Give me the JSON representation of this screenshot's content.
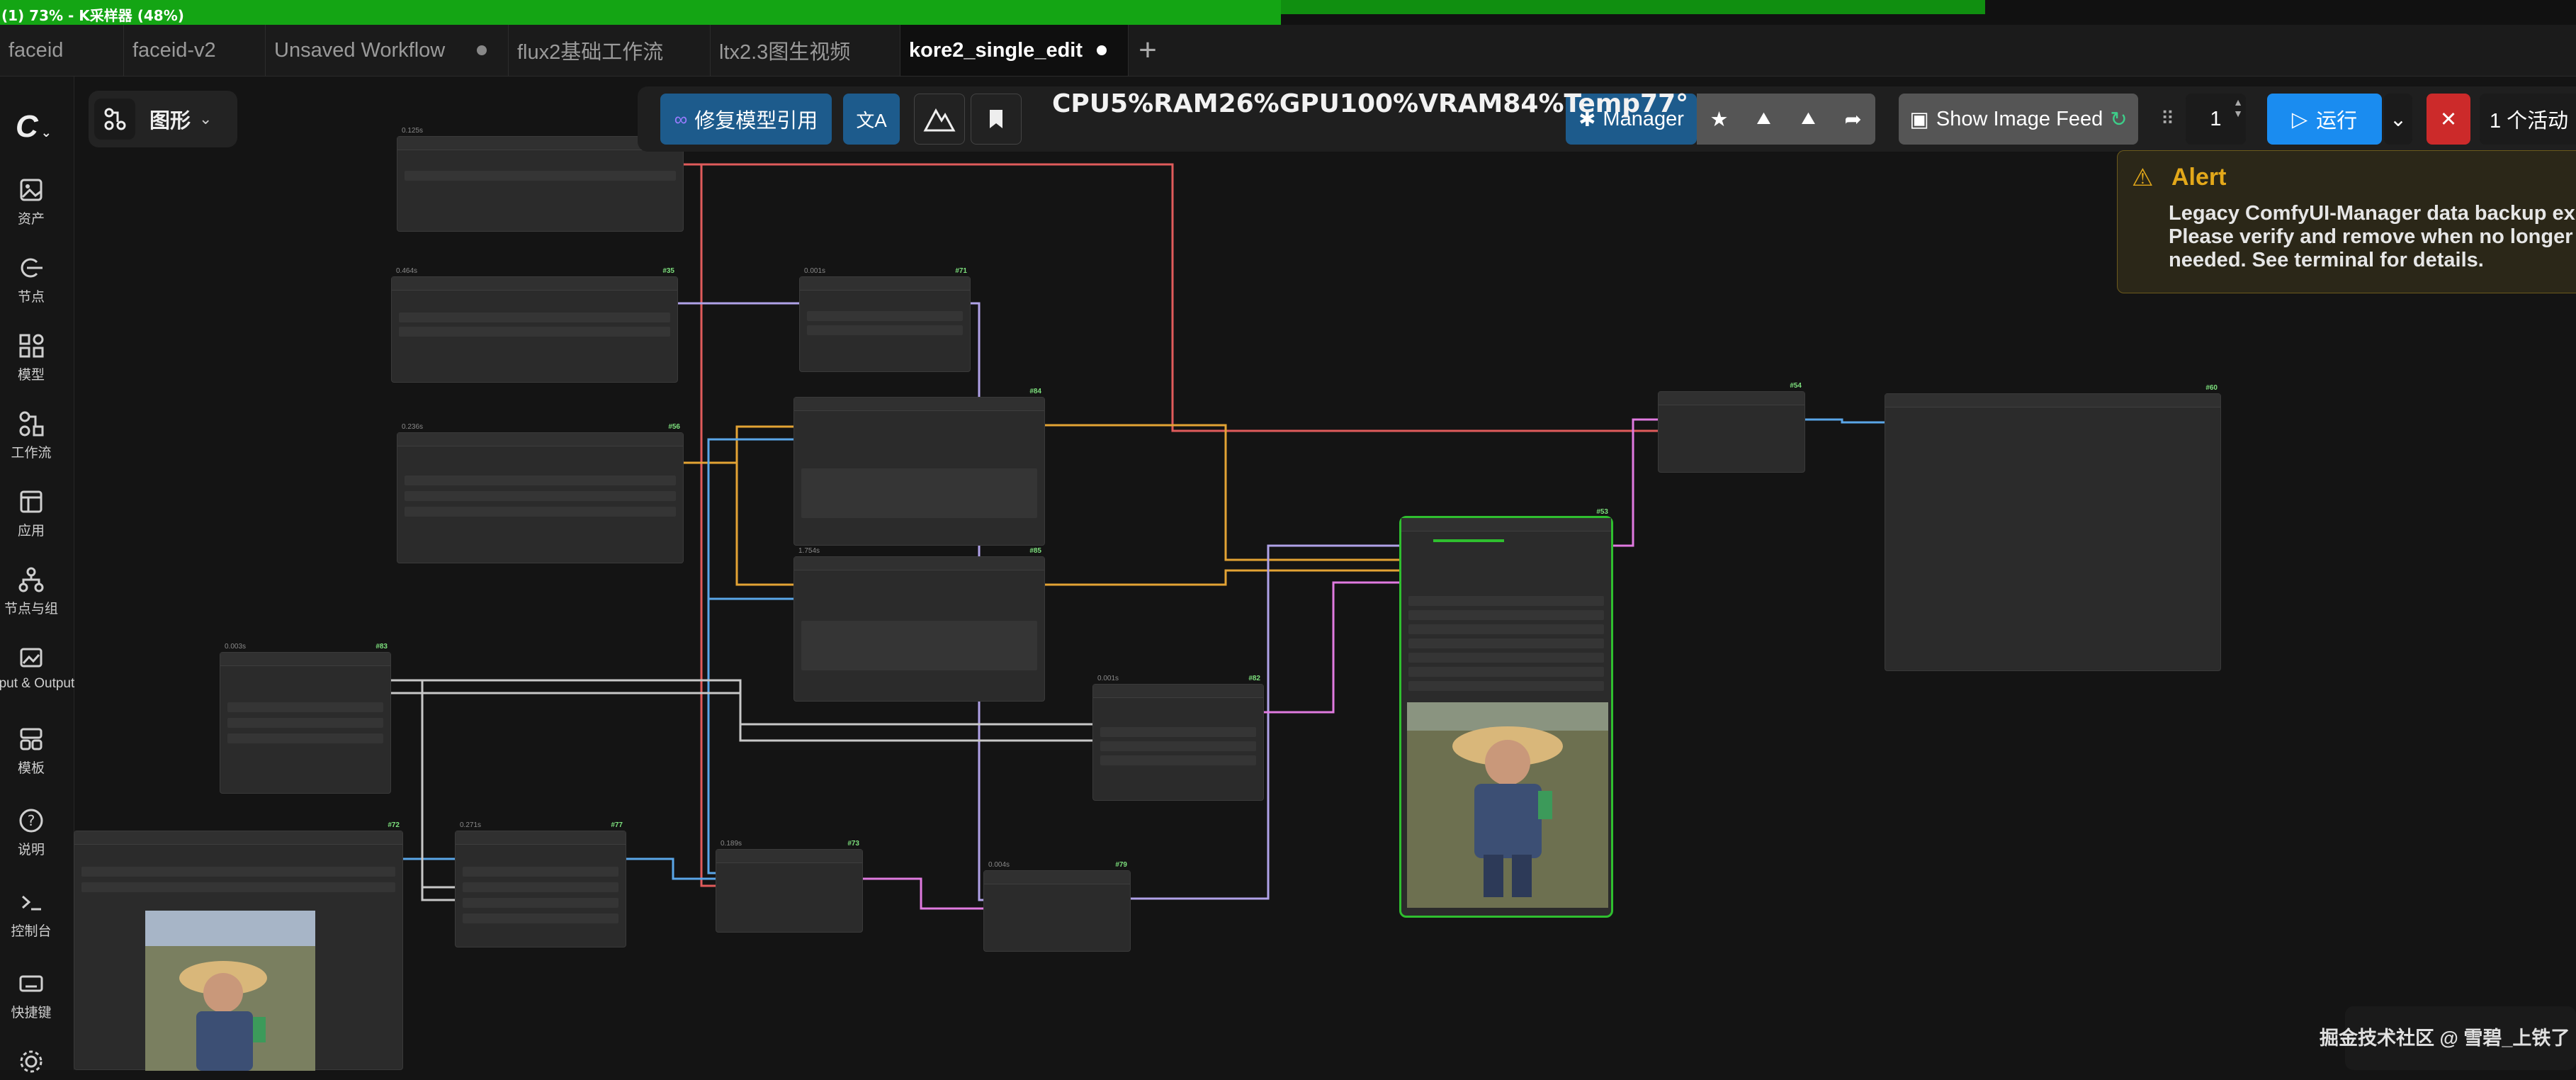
{
  "progress": {
    "text": "(1) 73% - K采样器 (48%)",
    "percent": 73,
    "sub_percent": 48
  },
  "tabs": [
    {
      "label": "faceid",
      "active": false,
      "unsaved": false
    },
    {
      "label": "faceid-v2",
      "active": false,
      "unsaved": false
    },
    {
      "label": "Unsaved Workflow",
      "active": false,
      "unsaved": true
    },
    {
      "label": "flux2基础工作流",
      "active": false,
      "unsaved": false
    },
    {
      "label": "ltx2.3图生视频",
      "active": false,
      "unsaved": false
    },
    {
      "label": "kore2_single_edit",
      "active": true,
      "unsaved": true
    }
  ],
  "tab_add": "+",
  "sidebar": {
    "items": [
      {
        "label": "资产",
        "icon": "image-icon"
      },
      {
        "label": "节点",
        "icon": "node-plug-icon"
      },
      {
        "label": "模型",
        "icon": "model-shapes-icon"
      },
      {
        "label": "工作流",
        "icon": "workflow-icon"
      },
      {
        "label": "应用",
        "icon": "app-window-icon"
      },
      {
        "label": "节点与组",
        "icon": "node-group-icon"
      },
      {
        "label": "Input & Output",
        "icon": "photo-io-icon"
      },
      {
        "label": "模板",
        "icon": "template-icon"
      },
      {
        "label": "说明",
        "icon": "help-icon"
      },
      {
        "label": "控制台",
        "icon": "terminal-icon"
      },
      {
        "label": "快捷键",
        "icon": "keyboard-icon"
      }
    ]
  },
  "graph_chip": {
    "label": "图形"
  },
  "toolbar": {
    "fix_model_ref": "修复模型引用",
    "stats": "CPU5%RAM26%GPU100%VRAM84%Temp77°",
    "manager": "Manager",
    "show_image_feed": "Show Image Feed",
    "queue_count": "1",
    "run": "运行",
    "active": "1 个活动"
  },
  "alert": {
    "title": "Alert",
    "message": "Legacy ComfyUI-Manager data backup exis\nPlease verify and remove when no longer\nneeded. See terminal for details."
  },
  "nodes": [
    {
      "id": "",
      "time": "0.125s"
    },
    {
      "id": "#35",
      "time": "0.464s"
    },
    {
      "id": "#71",
      "time": "0.001s"
    },
    {
      "id": "#56",
      "time": "0.236s"
    },
    {
      "id": "#84",
      "time": ""
    },
    {
      "id": "#85",
      "time": "1.754s"
    },
    {
      "id": "#83",
      "time": "0.003s"
    },
    {
      "id": "#82",
      "time": "0.001s"
    },
    {
      "id": "#53",
      "time": ""
    },
    {
      "id": "#54",
      "time": ""
    },
    {
      "id": "#60",
      "time": ""
    },
    {
      "id": "#72",
      "time": ""
    },
    {
      "id": "#77",
      "time": "0.271s"
    },
    {
      "id": "#73",
      "time": "0.189s"
    },
    {
      "id": "#79",
      "time": "0.004s"
    }
  ],
  "watermark": "掘金技术社区 @ 雪碧_上铁了",
  "colors": {
    "progress": "#14a514",
    "run_button": "#1a8cf0",
    "manager": "#1d5b8c",
    "alert_title": "#e3a81a",
    "selected_node": "#2fbf2f",
    "wire_red": "#e05b5b",
    "wire_orange": "#e3a334",
    "wire_blue": "#5aa6e8",
    "wire_lavender": "#b0a2e8",
    "wire_pink": "#e07ae0",
    "wire_gray": "#c8c8c8"
  }
}
